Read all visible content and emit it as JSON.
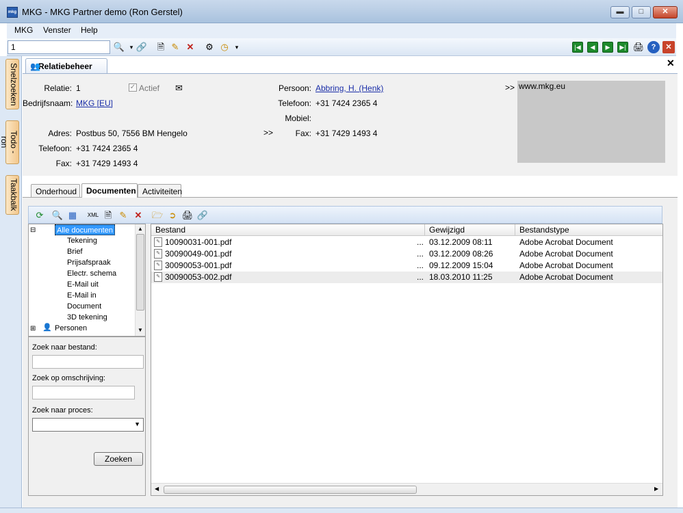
{
  "window": {
    "title": "MKG - MKG Partner demo (Ron Gerstel)",
    "icon_text": "mkg"
  },
  "menu": {
    "items": [
      "MKG",
      "Venster",
      "Help"
    ]
  },
  "toolbar": {
    "search_value": "1"
  },
  "side_tabs": [
    "Snelzoeken",
    "Todo - ron",
    "Taakbalk"
  ],
  "doc_tab": {
    "label": "Relatiebeheer"
  },
  "relatie": {
    "relatie_label": "Relatie:",
    "relatie_value": "1",
    "actief_label": "Actief",
    "bedrijfsnaam_label": "Bedrijfsnaam:",
    "bedrijfsnaam_value": "MKG [EU]",
    "adres_label": "Adres:",
    "adres_value": "Postbus 50, 7556 BM Hengelo",
    "telefoon_label": "Telefoon:",
    "telefoon_value": "+31 7424 2365 4",
    "fax_label": "Fax:",
    "fax_value": "+31 7429 1493 4",
    "arrow": ">>"
  },
  "persoon": {
    "persoon_label": "Persoon:",
    "persoon_value": "Abbring, H. (Henk)",
    "telefoon_label": "Telefoon:",
    "telefoon_value": "+31 7424 2365 4",
    "mobiel_label": "Mobiel:",
    "fax_label": "Fax:",
    "fax_value": "+31 7429 1493 4"
  },
  "website": {
    "arrow": ">>",
    "url": "www.mkg.eu"
  },
  "sub_tabs": [
    "Onderhoud",
    "Documenten",
    "Activiteiten"
  ],
  "tree": {
    "root": "Alle documenten",
    "children": [
      "Tekening",
      "Brief",
      "Prijsafspraak",
      "Electr. schema",
      "E-Mail uit",
      "E-Mail in",
      "Document",
      "3D tekening"
    ],
    "next": "Personen"
  },
  "search": {
    "bestand_label": "Zoek naar bestand:",
    "omschrijving_label": "Zoek op omschrijving:",
    "proces_label": "Zoek naar proces:",
    "button": "Zoeken"
  },
  "files": {
    "columns": [
      "Bestand",
      "Gewijzigd",
      "Bestandstype"
    ],
    "rows": [
      {
        "name": "10090031-001.pdf",
        "date": "03.12.2009 08:11",
        "type": "Adobe Acrobat Document"
      },
      {
        "name": "30090049-001.pdf",
        "date": "03.12.2009 08:26",
        "type": "Adobe Acrobat Document"
      },
      {
        "name": "30090053-001.pdf",
        "date": "09.12.2009 15:04",
        "type": "Adobe Acrobat Document"
      },
      {
        "name": "30090053-002.pdf",
        "date": "18.03.2010 11:25",
        "type": "Adobe Acrobat Document"
      }
    ],
    "ellipsis": "..."
  }
}
